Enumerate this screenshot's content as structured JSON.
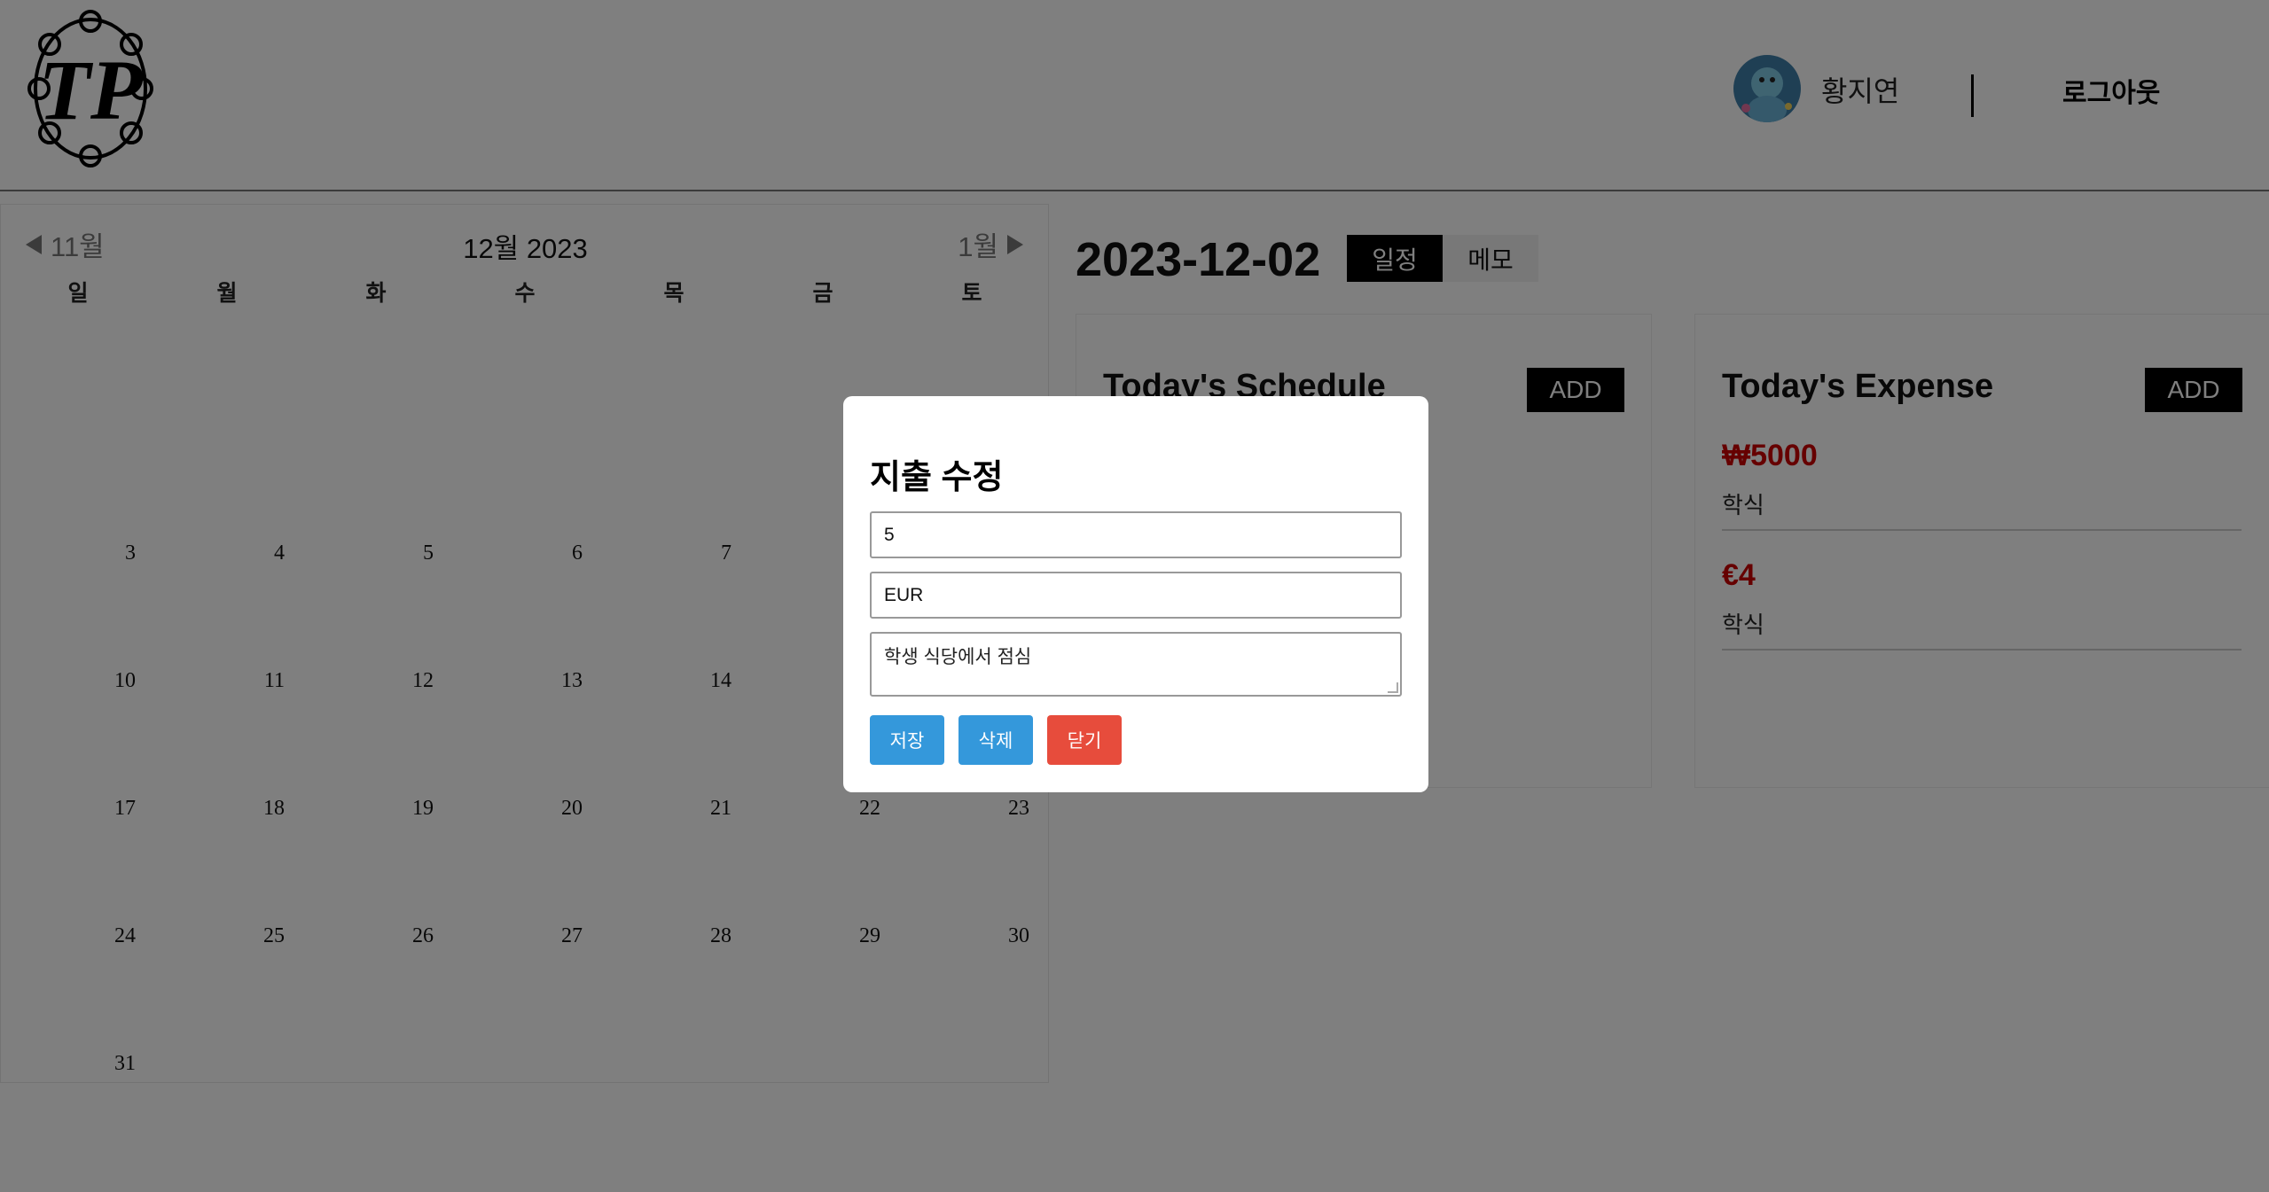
{
  "header": {
    "logo_text": "TP",
    "username": "황지연",
    "logout_label": "로그아웃"
  },
  "calendar": {
    "prev_label": "11월",
    "next_label": "1월",
    "title": "12월 2023",
    "weekdays": [
      "일",
      "월",
      "화",
      "수",
      "목",
      "금",
      "토"
    ],
    "days": [
      "3",
      "4",
      "5",
      "6",
      "7",
      "10",
      "11",
      "12",
      "13",
      "14",
      "17",
      "18",
      "19",
      "20",
      "21",
      "22",
      "23",
      "24",
      "25",
      "26",
      "27",
      "28",
      "29",
      "30",
      "31"
    ]
  },
  "detail": {
    "date": "2023-12-02",
    "tabs": {
      "schedule": "일정",
      "memo": "메모"
    },
    "schedule_title": "Today's Schedule",
    "schedule_add": "ADD",
    "expense_title": "Today's Expense",
    "expense_add": "ADD",
    "expenses": [
      {
        "amount": "₩5000",
        "desc": "학식"
      },
      {
        "amount": "€4",
        "desc": "학식"
      }
    ]
  },
  "modal": {
    "title": "지출 수정",
    "amount_value": "5",
    "currency_value": "EUR",
    "memo_value": "학생 식당에서 점심",
    "save_label": "저장",
    "delete_label": "삭제",
    "close_label": "닫기"
  },
  "colors": {
    "overlay": "rgba(0,0,0,0.5)",
    "expense_amount": "#c00000",
    "save_button": "#3498db",
    "delete_button": "#3498db",
    "close_button": "#e74c3c"
  }
}
